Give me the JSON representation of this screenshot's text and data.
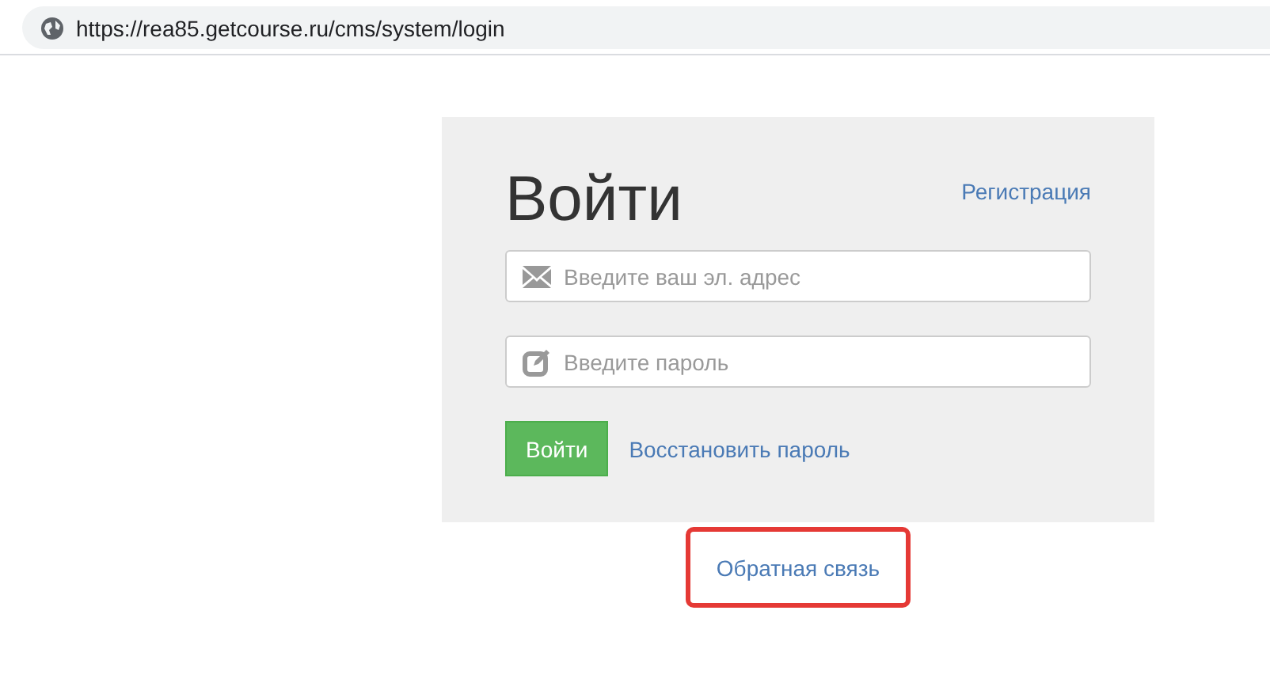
{
  "address_bar": {
    "url": "https://rea85.getcourse.ru/cms/system/login"
  },
  "login_form": {
    "title": "Войти",
    "register_link": "Регистрация",
    "fields": [
      {
        "kind": "email",
        "placeholder": "Введите ваш эл. адрес"
      },
      {
        "kind": "password",
        "placeholder": "Введите пароль"
      }
    ],
    "submit_button": "Войти",
    "restore_link": "Восстановить пароль"
  },
  "feedback_link": {
    "label": "Обратная связь",
    "highlighted": true
  }
}
